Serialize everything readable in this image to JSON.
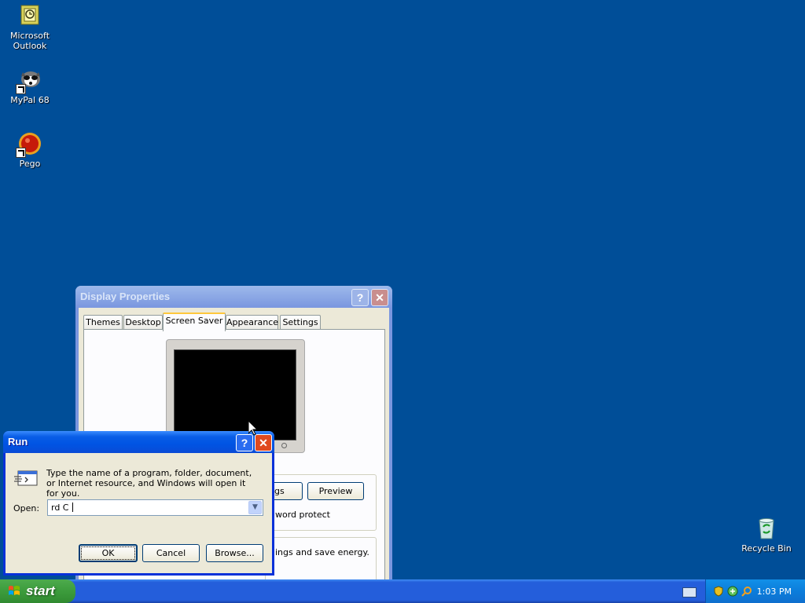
{
  "desktop": {
    "icons": [
      {
        "label": "Microsoft Outlook",
        "icon": "outlook-icon"
      },
      {
        "label": "MyPal 68",
        "icon": "mypal-icon"
      },
      {
        "label": "Pego",
        "icon": "pego-icon"
      }
    ],
    "recycle_bin": {
      "label": "Recycle Bin",
      "icon": "recycle-bin-icon"
    }
  },
  "display_properties": {
    "title": "Display Properties",
    "tabs": [
      "Themes",
      "Desktop",
      "Screen Saver",
      "Appearance",
      "Settings"
    ],
    "active_tab": "Screen Saver",
    "settings_partial": "ngs",
    "preview_label": "Preview",
    "password_partial": "word protect",
    "energy_partial": "ings and save energy."
  },
  "run_dialog": {
    "title": "Run",
    "description": "Type the name of a program, folder, document, or Internet resource, and Windows will open it for you.",
    "open_label": "Open:",
    "open_value": "rd C",
    "ok_label": "OK",
    "cancel_label": "Cancel",
    "browse_label": "Browse..."
  },
  "taskbar": {
    "start_label": "start",
    "clock": "1:03 PM"
  },
  "colors": {
    "desktop": "#004e98",
    "run_titlebar": "#0054e3",
    "start_button": "#3c9c3c"
  }
}
